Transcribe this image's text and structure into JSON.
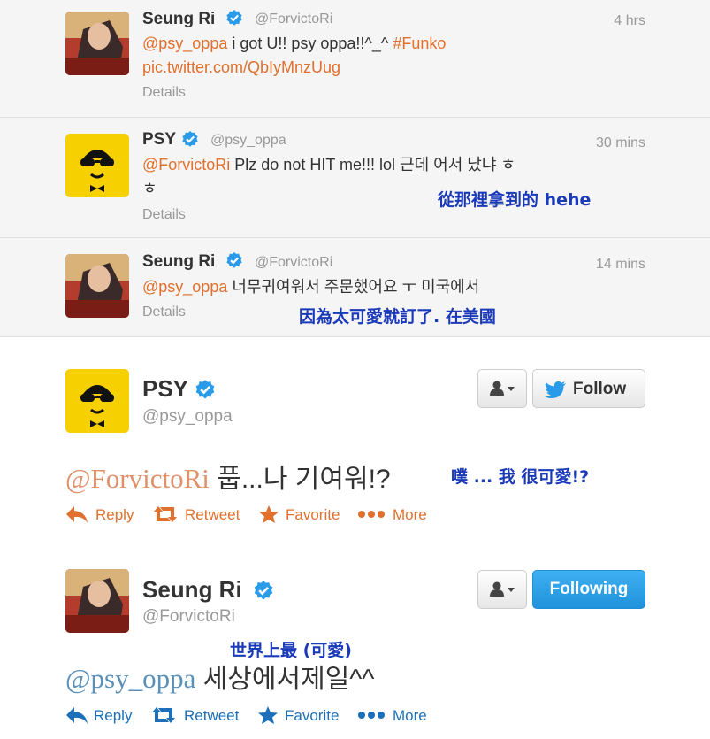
{
  "thread": [
    {
      "name": "Seung Ri",
      "handle": "@ForvictoRi",
      "time": "4 hrs",
      "mention": "@psy_oppa",
      "text": " i got U!! psy oppa!!^_^ ",
      "hashtag": "#Funko",
      "link": "pic.twitter.com/QbIyMnzUug",
      "details": "Details"
    },
    {
      "name": "PSY",
      "handle": "@psy_oppa",
      "time": "30 mins",
      "mention": "@ForvictoRi",
      "text_line1": " Plz do not HIT me!!! lol 근데 어서 났냐 ㅎ",
      "text_line2": "ㅎ",
      "annotation": "從那裡拿到的 hehe",
      "details": "Details"
    },
    {
      "name": "Seung Ri",
      "handle": "@ForvictoRi",
      "time": "14 mins",
      "mention": "@psy_oppa",
      "text": " 너무귀여워서 주문했어요 ㅜ 미국에서",
      "annotation": "因為太可愛就訂了. 在美國",
      "details": "Details"
    }
  ],
  "tweet_psy": {
    "name": "PSY",
    "handle": "@psy_oppa",
    "follow_label": "Follow",
    "mention": "@ForvictoRi",
    "text": " 풉...나 기여워!?",
    "annotation": "噗 ... 我 很可愛!?",
    "actions": {
      "reply": "Reply",
      "retweet": "Retweet",
      "favorite": "Favorite",
      "more": "More"
    }
  },
  "tweet_ri": {
    "name": "Seung Ri",
    "handle": "@ForvictoRi",
    "following_label": "Following",
    "mention": "@psy_oppa",
    "text": " 세상에서제일^^",
    "annotation": "世界上最 (可愛)",
    "actions": {
      "reply": "Reply",
      "retweet": "Retweet",
      "favorite": "Favorite",
      "more": "More"
    }
  },
  "colors": {
    "link_orange": "#e0702d",
    "link_blue": "#1c6fb8",
    "verified_blue": "#2a9be8",
    "annotation_blue": "#1a3ab8",
    "following_blue": "#1f92dc"
  },
  "icons": {
    "verified": "verified-badge-icon",
    "reply": "reply-arrow-icon",
    "retweet": "retweet-icon",
    "favorite": "star-icon",
    "more": "ellipsis-icon",
    "user": "user-dropdown-icon",
    "twitter": "twitter-bird-icon"
  }
}
